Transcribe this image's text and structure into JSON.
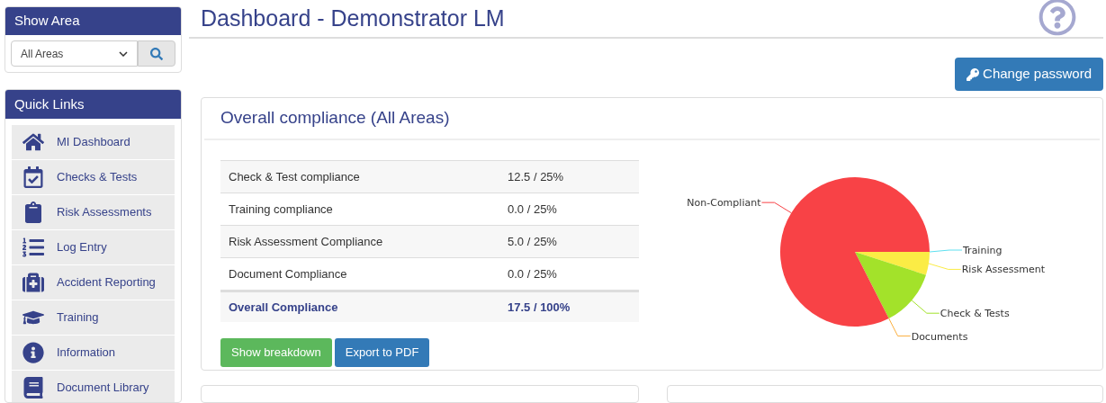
{
  "show_area": {
    "title": "Show Area",
    "select_value": "All Areas"
  },
  "quick_links": {
    "title": "Quick Links",
    "items": [
      {
        "label": "MI Dashboard",
        "kind": "home"
      },
      {
        "label": "Checks & Tests",
        "kind": "calendar"
      },
      {
        "label": "Risk Assessments",
        "kind": "clipboard"
      },
      {
        "label": "Log Entry",
        "kind": "list"
      },
      {
        "label": "Accident Reporting",
        "kind": "medkit"
      },
      {
        "label": "Training",
        "kind": "cap"
      },
      {
        "label": "Information",
        "kind": "info"
      },
      {
        "label": "Document Library",
        "kind": "book"
      }
    ]
  },
  "page_title": "Dashboard - Demonstrator LM",
  "change_password": "Change password",
  "compliance": {
    "title": "Overall compliance (All Areas)",
    "rows": [
      {
        "label": "Check & Test compliance",
        "value": "12.5 / 25%",
        "total": false
      },
      {
        "label": "Training compliance",
        "value": "0.0 / 25%",
        "total": false
      },
      {
        "label": "Risk Assessment Compliance",
        "value": "5.0 / 25%",
        "total": false
      },
      {
        "label": "Document Compliance",
        "value": "0.0 / 25%",
        "total": false
      },
      {
        "label": "Overall Compliance",
        "value": "17.5 / 100%",
        "total": true
      }
    ],
    "buttons": [
      {
        "label": "Show breakdown",
        "kind": "success"
      },
      {
        "label": "Export to PDF",
        "kind": "primary"
      }
    ],
    "chart_data": {
      "type": "pie",
      "categories": [
        "Training",
        "Risk Assessment",
        "Check & Tests",
        "Documents",
        "Non-Compliant"
      ],
      "values": [
        0,
        5,
        12.5,
        0,
        82.5
      ],
      "colors": [
        "#5ee0f0",
        "#fbec45",
        "#a3e22a",
        "#fbb040",
        "#f84246"
      ]
    }
  }
}
